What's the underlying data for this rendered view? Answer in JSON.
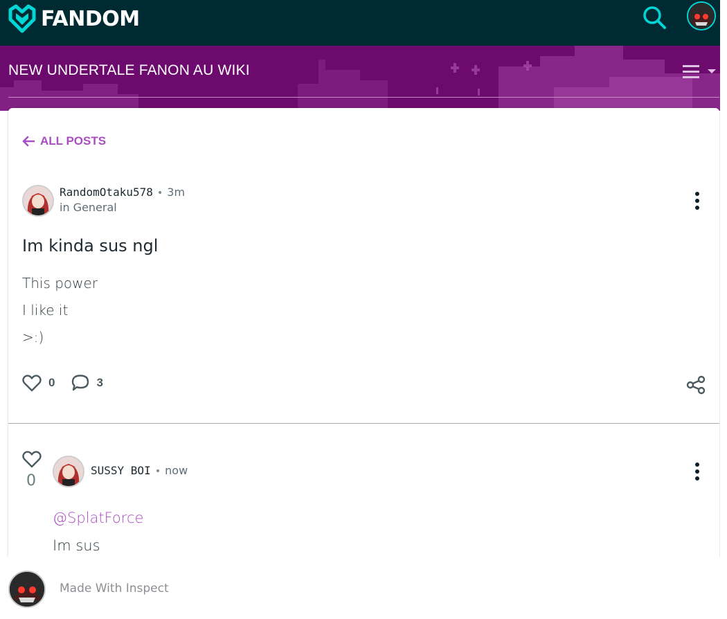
{
  "topbar": {
    "logo_text": "FANDOM",
    "logo_icon": "fandom-heart-icon",
    "search_icon": "search-icon",
    "avatar_icon": "user-avatar-icon",
    "accent_color": "#00d6d6",
    "background_color": "#002a32"
  },
  "community": {
    "title": "NEW UNDERTALE FANON AU WIKI",
    "menu_icon": "hamburger-menu-icon",
    "background_color": "#6d0a6e"
  },
  "post": {
    "back_label": "ALL POSTS",
    "author": "RandomOtaku578",
    "time": "3m",
    "category": "in General",
    "title": "Im kinda sus ngl",
    "body_lines": [
      "This power",
      "I like it",
      ">:)"
    ],
    "likes": "0",
    "comments": "3",
    "link_color": "#a94ec0"
  },
  "reply": {
    "likes": "0",
    "author": "SUSSY BOI",
    "time": "now",
    "mention": "@SplatForce",
    "text": "Im sus"
  },
  "footer": {
    "label": "Made With Inspect"
  }
}
